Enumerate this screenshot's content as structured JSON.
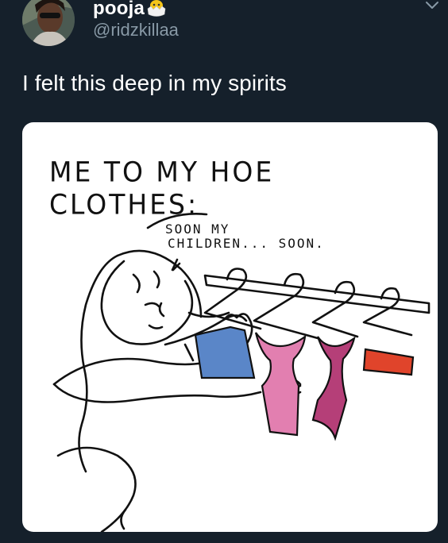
{
  "user": {
    "display_name": "pooja",
    "handle": "@ridzkillaa",
    "name_emoji": "hatching-chick-emoji"
  },
  "tweet": {
    "text": "I felt this deep in my spirits"
  },
  "media": {
    "title": "ME TO MY HOE CLOTHES:",
    "speech_line_1": "SOON MY",
    "speech_line_2": "CHILDREN... SOON.",
    "colors": {
      "blue_top": "#5a86c8",
      "pink_dress": "#e27fb0",
      "magenta_dress": "#b53f78",
      "red_top": "#e0442b"
    }
  },
  "icons": {
    "menu": "chevron-down-icon"
  },
  "theme": {
    "background": "#15202b",
    "text": "#ffffff",
    "secondary_text": "#8899a6"
  }
}
